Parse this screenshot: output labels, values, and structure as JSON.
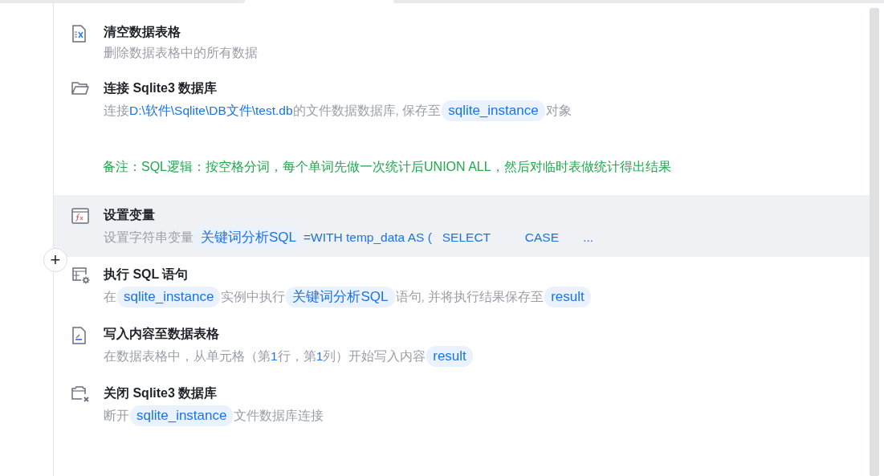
{
  "steps": [
    {
      "kind": "command",
      "selected": false,
      "title": "清空数据表格",
      "description": [
        {
          "kind": "text",
          "text": "删除数据表格中的所有数据"
        }
      ]
    },
    {
      "kind": "command",
      "selected": false,
      "title": "连接 Sqlite3 数据库",
      "description": [
        {
          "kind": "text",
          "text": "连接"
        },
        {
          "kind": "value",
          "text": "D:\\软件\\Sqlite\\DB文件\\test.db"
        },
        {
          "kind": "text",
          "text": "的文件数据数据库, 保存至"
        },
        {
          "kind": "variable",
          "text": "sqlite_instance"
        },
        {
          "kind": "text",
          "text": "对象"
        }
      ]
    },
    {
      "kind": "comment",
      "text": "备注：SQL逻辑：按空格分词，每个单词先做一次统计后UNION ALL，然后对临时表做统计得出结果"
    },
    {
      "kind": "command",
      "selected": true,
      "title": "设置变量",
      "description": [
        {
          "kind": "text",
          "text": "设置字符串变量"
        },
        {
          "kind": "variable",
          "text": "关键词分析SQL"
        },
        {
          "kind": "value",
          "text": "=WITH temp_data AS (   SELECT          CASE       ..."
        }
      ]
    },
    {
      "kind": "command",
      "selected": false,
      "title": "执行 SQL 语句",
      "description": [
        {
          "kind": "text",
          "text": "在"
        },
        {
          "kind": "variable",
          "text": "sqlite_instance"
        },
        {
          "kind": "text",
          "text": "实例中执行"
        },
        {
          "kind": "variable",
          "text": "关键词分析SQL"
        },
        {
          "kind": "text",
          "text": "语句, 并将执行结果保存至"
        },
        {
          "kind": "variable",
          "text": "result"
        }
      ]
    },
    {
      "kind": "command",
      "selected": false,
      "title": "写入内容至数据表格",
      "description": [
        {
          "kind": "text",
          "text": "在数据表格中，从单元格（第"
        },
        {
          "kind": "value",
          "text": "1"
        },
        {
          "kind": "text",
          "text": "行，第"
        },
        {
          "kind": "value",
          "text": "1"
        },
        {
          "kind": "text",
          "text": "列）开始写入内容"
        },
        {
          "kind": "variable",
          "text": "result"
        }
      ]
    },
    {
      "kind": "command",
      "selected": false,
      "title": "关闭 Sqlite3 数据库",
      "description": [
        {
          "kind": "text",
          "text": "断开"
        },
        {
          "kind": "variable",
          "text": "sqlite_instance"
        },
        {
          "kind": "text",
          "text": "文件数据库连接"
        }
      ]
    }
  ],
  "add_button": {
    "label": "+"
  }
}
